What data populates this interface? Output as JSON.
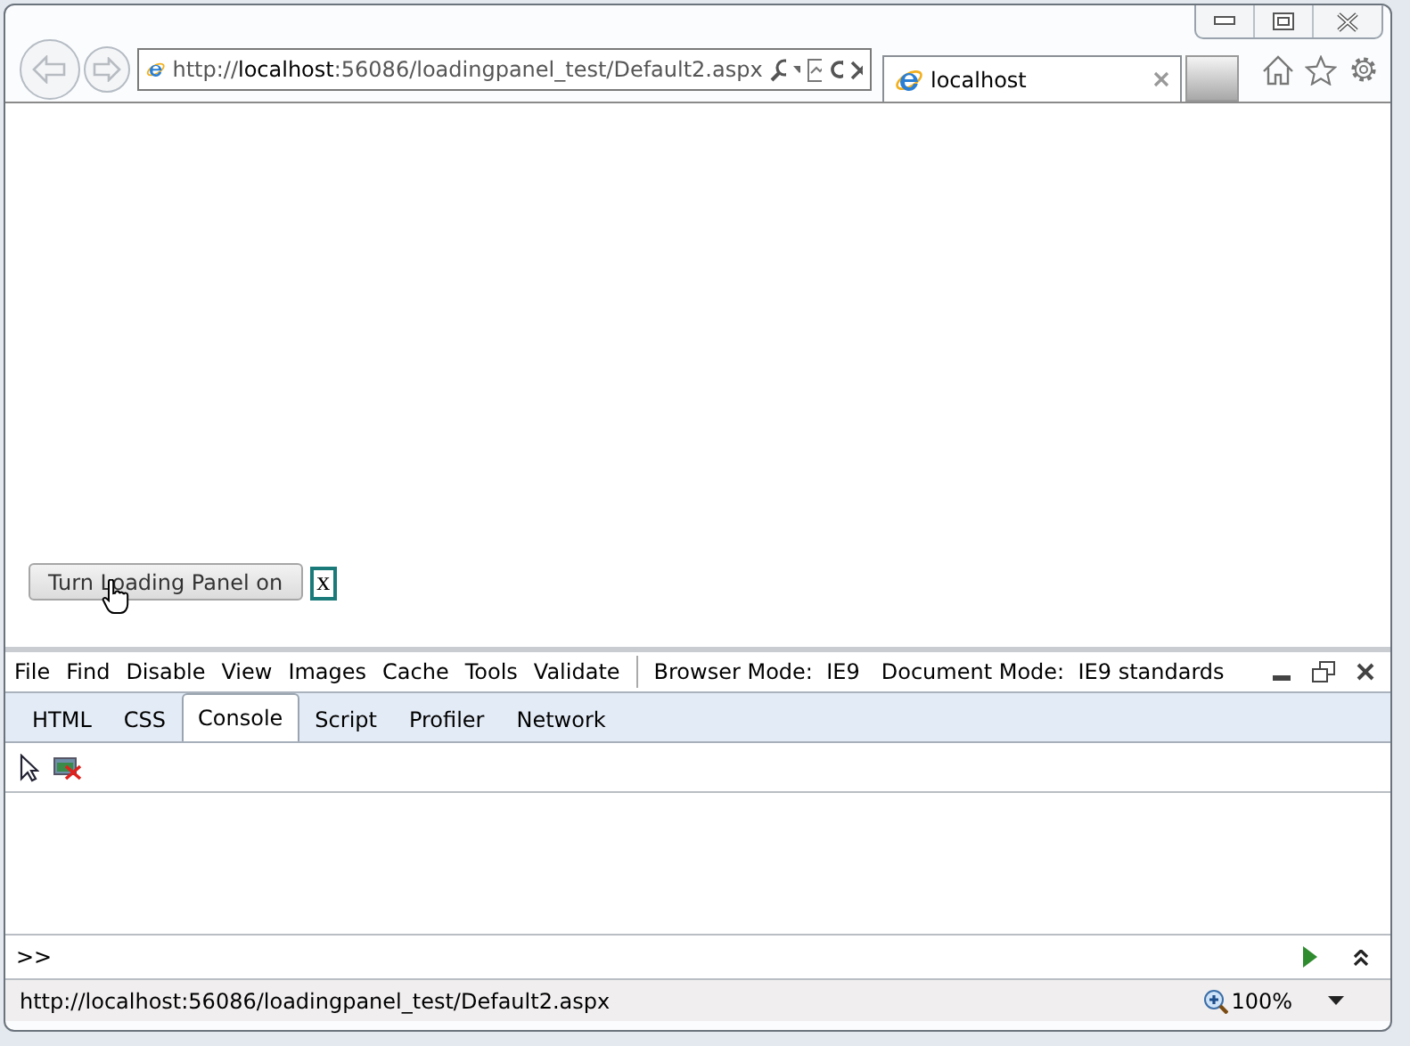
{
  "address_bar": {
    "url": "http://**localhost**:56086/loadingpanel_test/Default2.aspx"
  },
  "tabs": [
    {
      "title": "localhost",
      "selected": true
    }
  ],
  "page": {
    "button": "Turn Loading Panel on",
    "box_text": "x"
  },
  "devtools": {
    "menu": [
      "File",
      "Find",
      "Disable",
      "View",
      "Images",
      "Cache",
      "Tools",
      "Validate"
    ],
    "modes": [
      {
        "label": "Browser Mode:",
        "value": "IE9"
      },
      {
        "label": "Document Mode:",
        "value": "IE9 standards"
      }
    ],
    "tabs": [
      {
        "label": "HTML",
        "selected": false
      },
      {
        "label": "CSS",
        "selected": false
      },
      {
        "label": "Console",
        "selected": true
      },
      {
        "label": "Script",
        "selected": false
      },
      {
        "label": "Profiler",
        "selected": false
      },
      {
        "label": "Network",
        "selected": false
      }
    ],
    "prompt": ">>"
  },
  "status_bar": {
    "url": "http://localhost:56086/loadingpanel_test/Default2.aspx",
    "zoom": "100%"
  }
}
